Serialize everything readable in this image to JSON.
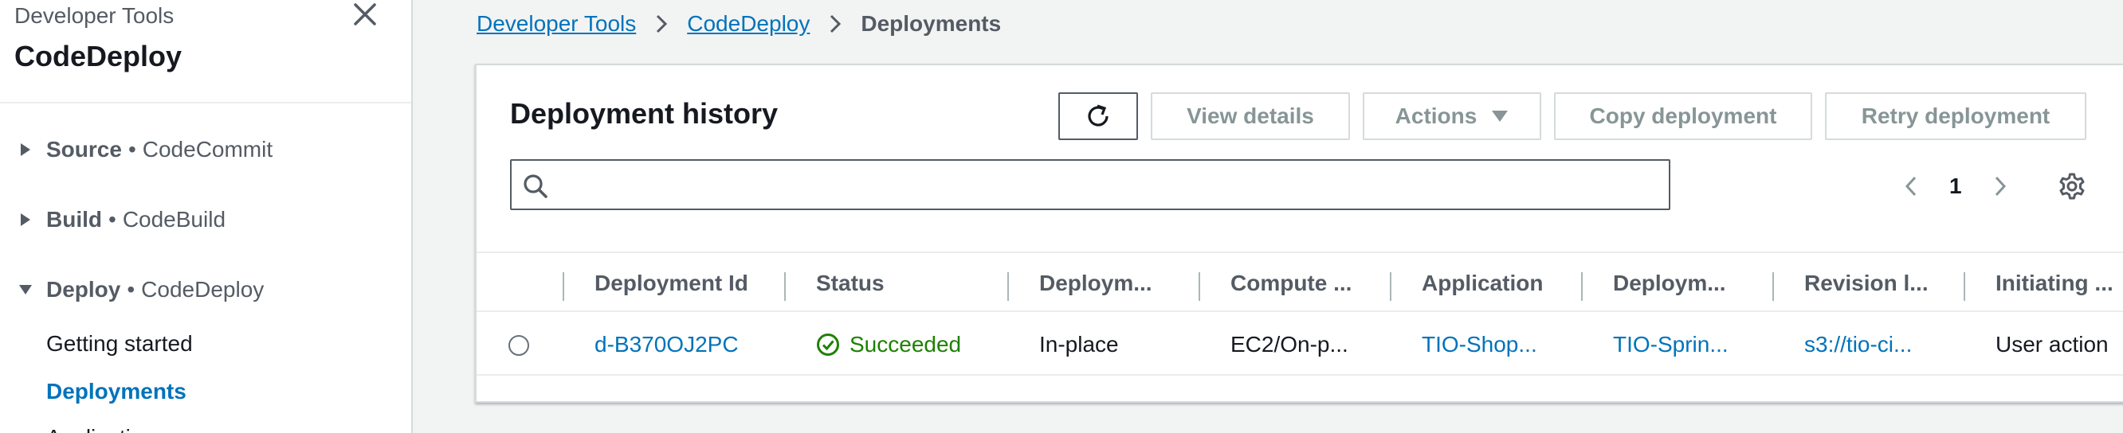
{
  "sidebar": {
    "service_group": "Developer Tools",
    "service_name": "CodeDeploy",
    "sections": [
      {
        "label": "Source",
        "service": "CodeCommit",
        "expanded": false
      },
      {
        "label": "Build",
        "service": "CodeBuild",
        "expanded": false
      },
      {
        "label": "Deploy",
        "service": "CodeDeploy",
        "expanded": true
      }
    ],
    "bullet": "•",
    "links": [
      {
        "label": "Getting started",
        "active": false
      },
      {
        "label": "Deployments",
        "active": true
      },
      {
        "label": "Applications",
        "active": false
      }
    ]
  },
  "breadcrumb": {
    "items": [
      "Developer Tools",
      "CodeDeploy"
    ],
    "current": "Deployments"
  },
  "panel": {
    "title": "Deployment history",
    "buttons": {
      "view_details": "View details",
      "actions": "Actions",
      "copy": "Copy deployment",
      "retry": "Retry deployment"
    },
    "search": {
      "value": "",
      "placeholder": ""
    },
    "pagination": {
      "current_page": "1"
    }
  },
  "table": {
    "columns": [
      "Deployment Id",
      "Status",
      "Deploym...",
      "Compute ...",
      "Application",
      "Deploym...",
      "Revision l...",
      "Initiating ..."
    ],
    "rows": [
      {
        "deployment_id": "d-B370OJ2PC",
        "status": "Succeeded",
        "deployment_type": "In-place",
        "compute_platform": "EC2/On-p...",
        "application": "TIO-Shop...",
        "deployment_group": "TIO-Sprin...",
        "revision_location": "s3://tio-ci...",
        "initiating_event": "User action"
      }
    ]
  },
  "colors": {
    "link": "#0073bb",
    "success": "#1d8102",
    "text": "#16191f",
    "muted": "#545b64",
    "disabled": "#879596",
    "border": "#d5dbdb",
    "background": "#f2f3f3"
  }
}
